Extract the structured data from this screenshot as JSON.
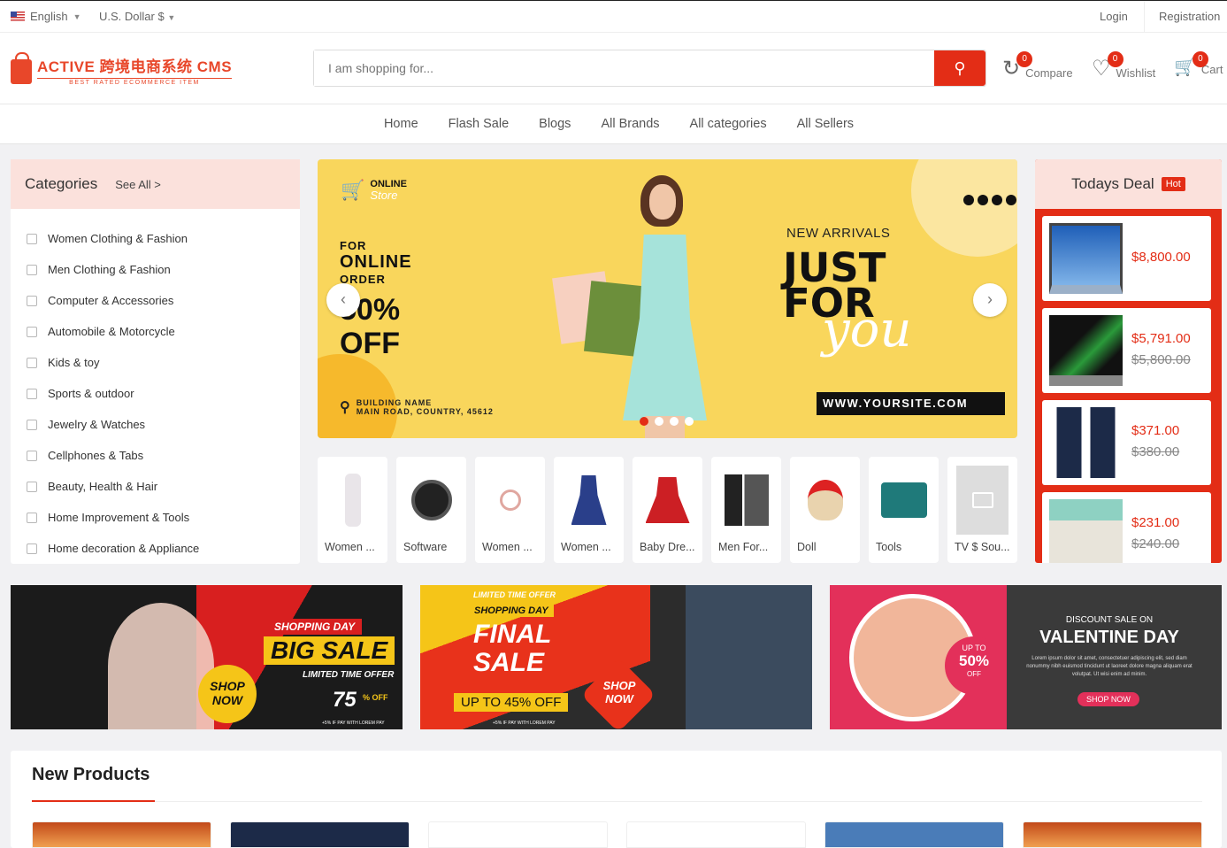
{
  "topbar": {
    "language": "English",
    "currency": "U.S. Dollar $",
    "login": "Login",
    "registration": "Registration"
  },
  "logo": {
    "title": "ACTIVE 跨境电商系统 CMS",
    "subtitle": "BEST RATED ECOMMERCE ITEM"
  },
  "search": {
    "placeholder": "I am shopping for..."
  },
  "header_actions": [
    {
      "label": "Compare",
      "count": "0",
      "icon": "compare-icon"
    },
    {
      "label": "Wishlist",
      "count": "0",
      "icon": "heart-icon"
    },
    {
      "label": "Cart",
      "count": "0",
      "icon": "cart-icon"
    }
  ],
  "nav": [
    "Home",
    "Flash Sale",
    "Blogs",
    "All Brands",
    "All categories",
    "All Sellers"
  ],
  "categories": {
    "title": "Categories",
    "see_all": "See All >",
    "items": [
      "Women Clothing & Fashion",
      "Men Clothing & Fashion",
      "Computer & Accessories",
      "Automobile & Motorcycle",
      "Kids & toy",
      "Sports & outdoor",
      "Jewelry & Watches",
      "Cellphones & Tabs",
      "Beauty, Health & Hair",
      "Home Improvement & Tools",
      "Home decoration & Appliance"
    ]
  },
  "slider": {
    "store_line1": "ONLINE",
    "store_line2": "Store",
    "for": "FOR",
    "online": "ONLINE",
    "order": "ORDER",
    "percent": "50%",
    "off": "OFF",
    "address_1": "BUILDING NAME",
    "address_2": "MAIN ROAD, COUNTRY, 45612",
    "new_arrivals": "NEW ARRIVALS",
    "just": "JUST",
    "for_big": "FOR",
    "you": "you",
    "website": "WWW.YOURSITE.COM",
    "active_slide": 1,
    "slide_count": 4
  },
  "featured_categories": [
    "Women ...",
    "Software",
    "Women ...",
    "Women ...",
    "Baby Dre...",
    "Men For...",
    "Doll",
    "Tools",
    "TV $ Sou..."
  ],
  "todays_deal": {
    "title": "Todays Deal",
    "badge": "Hot",
    "items": [
      {
        "price": "$8,800.00",
        "old_price": ""
      },
      {
        "price": "$5,791.00",
        "old_price": "$5,800.00"
      },
      {
        "price": "$371.00",
        "old_price": "$380.00"
      },
      {
        "price": "$231.00",
        "old_price": "$240.00"
      }
    ]
  },
  "banners": [
    {
      "tag": "SHOPPING DAY",
      "headline": "BIG SALE",
      "sub": "LIMITED TIME OFFER",
      "cta": "SHOP NOW",
      "value": "75",
      "pct": "% OFF",
      "fine": "+5% IF PAY WITH LOREM PAY"
    },
    {
      "top": "LIMITED TIME OFFER",
      "tag": "SHOPPING DAY",
      "headline1": "FINAL",
      "headline2": "SALE",
      "sub": "UP TO 45% OFF",
      "cta": "SHOP NOW",
      "fine": "+5% IF PAY WITH LOREM PAY"
    },
    {
      "pre": "DISCOUNT SALE ON",
      "headline": "VALENTINE DAY",
      "upto": "UP TO",
      "value": "50%",
      "off": "OFF",
      "body": "Lorem ipsum dolor sit amet, consectetuer adipiscing elit, sed diam nonummy nibh euismod tincidunt ut laoreet dolore magna aliquam erat volutpat. Ut wisi enim ad minim.",
      "cta": "SHOP NOW"
    }
  ],
  "new_products": {
    "title": "New Products"
  },
  "colors": {
    "accent": "#e32d16",
    "header_tint": "#fbe1dc",
    "slider_bg": "#f9d65c"
  }
}
